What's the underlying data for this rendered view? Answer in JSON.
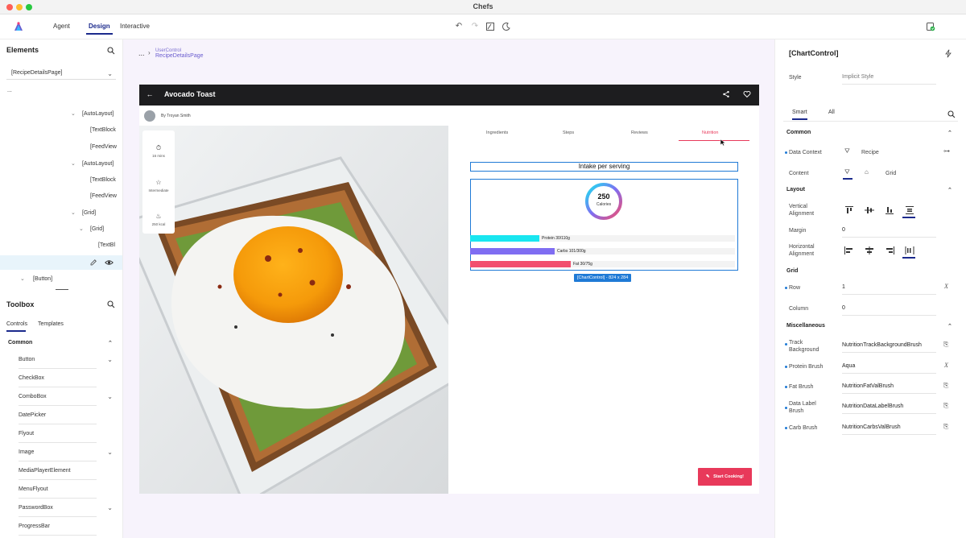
{
  "window": {
    "title": "Chefs"
  },
  "toolbar": {
    "tabs": [
      "Agent",
      "Design",
      "Interactive"
    ],
    "active_tab": "Design"
  },
  "elements_panel": {
    "title": "Elements",
    "page_selector": "[RecipeDetailsPage]",
    "more": "...",
    "tree": [
      {
        "label": "[AutoLayout]",
        "expander": "⌄"
      },
      {
        "label": "[TextBlock"
      },
      {
        "label": "[FeedView"
      },
      {
        "label": "[AutoLayout]",
        "expander": "⌄"
      },
      {
        "label": "[TextBlock"
      },
      {
        "label": "[FeedView"
      },
      {
        "label": "[Grid]",
        "expander": "⌄"
      },
      {
        "label": "[Grid]",
        "expander": "⌄"
      },
      {
        "label": "[TextBl"
      },
      {
        "label": "[Button]",
        "expander": "⌄"
      }
    ]
  },
  "toolbox": {
    "title": "Toolbox",
    "tabs": [
      "Controls",
      "Templates"
    ],
    "group": "Common",
    "controls": [
      {
        "label": "Button",
        "expandable": true
      },
      {
        "label": "CheckBox",
        "expandable": false
      },
      {
        "label": "ComboBox",
        "expandable": true
      },
      {
        "label": "DatePicker",
        "expandable": false
      },
      {
        "label": "Flyout",
        "expandable": false
      },
      {
        "label": "Image",
        "expandable": true
      },
      {
        "label": "MediaPlayerElement",
        "expandable": false
      },
      {
        "label": "MenuFlyout",
        "expandable": false
      },
      {
        "label": "PasswordBox",
        "expandable": true
      },
      {
        "label": "ProgressBar",
        "expandable": false
      }
    ]
  },
  "breadcrumb": {
    "more": "...",
    "parent": "UserControl",
    "current": "RecipeDetailsPage"
  },
  "app": {
    "title": "Avocado Toast",
    "author": "By Troyan Smith",
    "stats": [
      {
        "icon": "timer-icon",
        "text": "16 mins"
      },
      {
        "icon": "star-icon",
        "text": "Intermediate"
      },
      {
        "icon": "flame-icon",
        "text": "250 kcal"
      }
    ],
    "tabs": [
      "Ingredients",
      "Steps",
      "Reviews",
      "Nutrition"
    ],
    "active_tab": "Nutrition",
    "start_button": "Start Cooking!",
    "accent_color": "#e8395a"
  },
  "nutrition": {
    "title": "Intake per serving",
    "calories_value": "250",
    "calories_label": "Calories",
    "selection_badge": "[ChartControl] - 824 x 284",
    "bars": [
      {
        "label": "Protein 30/110g",
        "fraction": 0.26,
        "color": "#19e6f0"
      },
      {
        "label": "Carbs 101/300g",
        "fraction": 0.32,
        "color": "#7f6df2"
      },
      {
        "label": "Fat 30/75g",
        "fraction": 0.38,
        "color": "#f24e6e"
      }
    ]
  },
  "properties": {
    "title": "[ChartControl]",
    "style_label": "Style",
    "style_value": "Implicit Style",
    "tabs": [
      "Smart",
      "All"
    ],
    "sections": {
      "common": "Common",
      "layout": "Layout",
      "grid": "Grid",
      "misc": "Miscellaneous"
    },
    "data_context_label": "Data Context",
    "data_context_value": "Recipe",
    "content_label": "Content",
    "content_value": "Grid",
    "vertical_alignment_label": "Vertical Alignment",
    "margin_label": "Margin",
    "margin_value": "0",
    "horizontal_alignment_label": "Horizontal Alignment",
    "row_label": "Row",
    "row_value": "1",
    "column_label": "Column",
    "column_value": "0",
    "track_background_label": "Track Background",
    "track_background_value": "NutritionTrackBackgroundBrush",
    "protein_brush_label": "Protein Brush",
    "protein_brush_value": "Aqua",
    "fat_brush_label": "Fat Brush",
    "fat_brush_value": "NutritionFatValBrush",
    "data_label_brush_label": "Data Label Brush",
    "data_label_brush_value": "NutritionDataLabelBrush",
    "carb_brush_label": "Carb Brush",
    "carb_brush_value": "NutritionCarbsValBrush"
  }
}
